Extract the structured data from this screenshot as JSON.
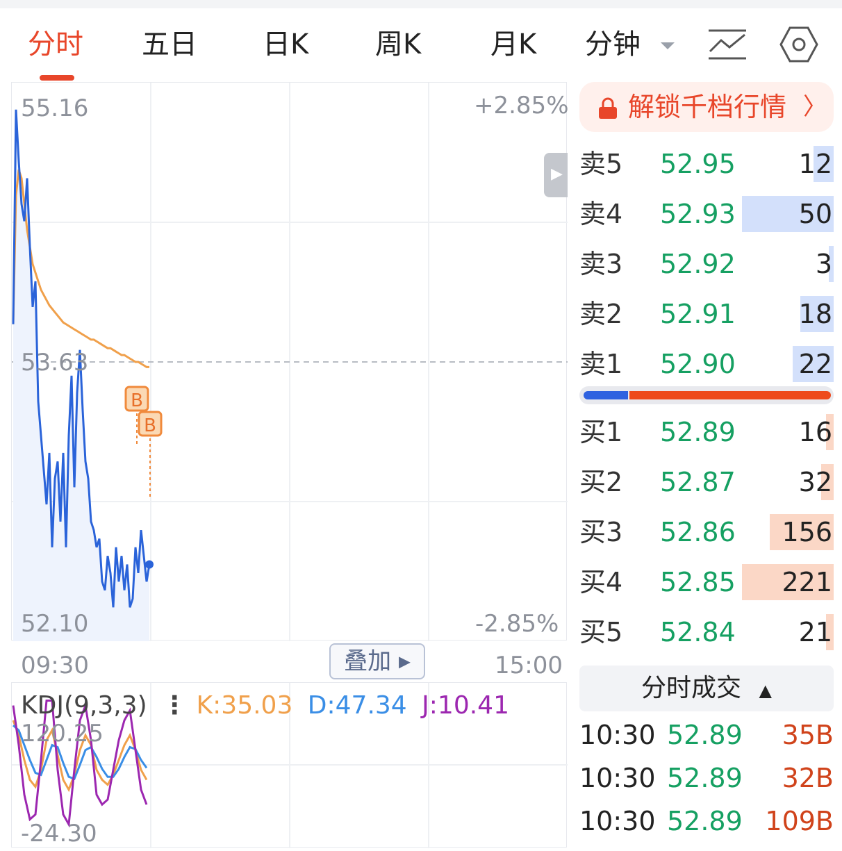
{
  "tabs": [
    {
      "label": "分时",
      "active": true
    },
    {
      "label": "五日"
    },
    {
      "label": "日K"
    },
    {
      "label": "周K"
    },
    {
      "label": "月K"
    },
    {
      "label": "分钟",
      "dropdown": true
    }
  ],
  "icons": [
    "indicator-line-icon",
    "settings-hexagon-icon"
  ],
  "chart": {
    "price_high": "55.16",
    "price_mid": "53.63",
    "price_low": "52.10",
    "pct_high": "+2.85%",
    "pct_low": "-2.85%",
    "time_start": "09:30",
    "time_end": "15:00",
    "overlay_label": "叠加",
    "markers": [
      "B",
      "B"
    ],
    "colors": {
      "price_line": "#2a63d9",
      "avg_line": "#f0a04b",
      "fill": "#eef3fd",
      "marker": "#f08a3c"
    }
  },
  "chart_data": {
    "type": "line",
    "ylim": [
      52.1,
      55.16
    ],
    "series": [
      {
        "values": [
          53.85,
          55.1,
          54.8,
          54.55,
          54.45,
          54.7,
          54.3,
          53.95,
          54.1,
          53.4,
          53.2,
          53.0,
          52.8,
          53.1,
          52.55,
          52.95,
          53.05,
          52.7,
          53.1,
          52.55,
          53.2,
          53.55,
          52.9,
          53.45,
          53.7,
          53.35,
          53.05,
          52.95,
          52.7,
          52.65,
          52.55,
          52.6,
          52.35,
          52.3,
          52.5,
          52.4,
          52.2,
          52.55,
          52.35,
          52.5,
          52.3,
          52.45,
          52.2,
          52.25,
          52.55,
          52.4,
          52.65,
          52.5,
          52.35,
          52.45
        ]
      },
      {
        "values": [
          53.85,
          54.6,
          54.75,
          54.7,
          54.55,
          54.4,
          54.3,
          54.2,
          54.15,
          54.1,
          54.05,
          54.02,
          53.99,
          53.96,
          53.94,
          53.92,
          53.9,
          53.88,
          53.86,
          53.85,
          53.84,
          53.83,
          53.82,
          53.81,
          53.8,
          53.79,
          53.78,
          53.77,
          53.76,
          53.76,
          53.75,
          53.74,
          53.73,
          53.72,
          53.71,
          53.71,
          53.7,
          53.69,
          53.68,
          53.67,
          53.67,
          53.66,
          53.65,
          53.64,
          53.63,
          53.63,
          53.62,
          53.61,
          53.6,
          53.6
        ]
      }
    ]
  },
  "kdj": {
    "title": "KDJ(9,3,3)",
    "k": "K:35.03",
    "d": "D:47.34",
    "j": "J:10.41",
    "max": "120.25",
    "min": "-24.30",
    "colors": {
      "k": "#f0a04b",
      "d": "#3a8ee6",
      "j": "#9c27b0"
    },
    "k_values": [
      95,
      80,
      55,
      35,
      28,
      45,
      75,
      85,
      60,
      35,
      25,
      40,
      65,
      80,
      70,
      45,
      35,
      30,
      40,
      55,
      70,
      80,
      65,
      45,
      35
    ],
    "d_values": [
      90,
      85,
      70,
      55,
      42,
      40,
      55,
      70,
      68,
      52,
      38,
      36,
      50,
      65,
      68,
      58,
      46,
      38,
      38,
      46,
      58,
      68,
      66,
      55,
      47
    ],
    "j_values": [
      110,
      70,
      20,
      -5,
      0,
      55,
      115,
      115,
      45,
      0,
      -10,
      45,
      95,
      110,
      75,
      20,
      10,
      15,
      45,
      75,
      95,
      105,
      65,
      25,
      10
    ]
  },
  "unlock_banner": "解锁千档行情",
  "asks": [
    {
      "label": "卖5",
      "price": "52.95",
      "vol": "12",
      "share": 0.08
    },
    {
      "label": "卖4",
      "price": "52.93",
      "vol": "50",
      "share": 0.36
    },
    {
      "label": "卖3",
      "price": "52.92",
      "vol": "3",
      "share": 0.02
    },
    {
      "label": "卖2",
      "price": "52.91",
      "vol": "18",
      "share": 0.13
    },
    {
      "label": "卖1",
      "price": "52.90",
      "vol": "22",
      "share": 0.16
    }
  ],
  "bids": [
    {
      "label": "买1",
      "price": "52.89",
      "vol": "16",
      "share": 0.03
    },
    {
      "label": "买2",
      "price": "52.87",
      "vol": "32",
      "share": 0.05
    },
    {
      "label": "买3",
      "price": "52.86",
      "vol": "156",
      "share": 0.25
    },
    {
      "label": "买4",
      "price": "52.85",
      "vol": "221",
      "share": 0.36
    },
    {
      "label": "买5",
      "price": "52.84",
      "vol": "21",
      "share": 0.03
    }
  ],
  "ratio": {
    "buy": 0.18,
    "sell": 0.82
  },
  "trades_header": "分时成交",
  "trades": [
    {
      "time": "10:30",
      "price": "52.89",
      "vol": "35B"
    },
    {
      "time": "10:30",
      "price": "52.89",
      "vol": "32B"
    },
    {
      "time": "10:30",
      "price": "52.89",
      "vol": "109B"
    }
  ]
}
